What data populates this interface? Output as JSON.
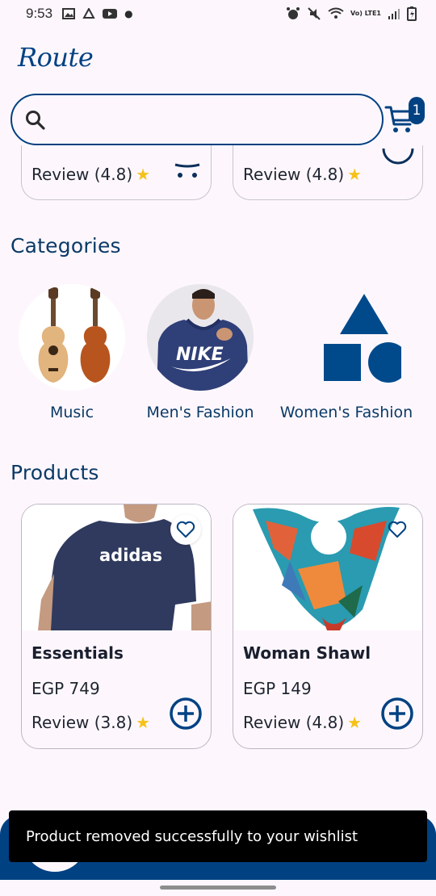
{
  "status_bar": {
    "time": "9:53",
    "network": "Vo) LTE1"
  },
  "header": {
    "logo": "Route",
    "cart_count": "1"
  },
  "search": {
    "placeholder": ""
  },
  "top_cards": [
    {
      "review": "Review (4.8)"
    },
    {
      "review": "Review (4.8)"
    }
  ],
  "categories": {
    "title": "Categories",
    "items": [
      {
        "label": "Music"
      },
      {
        "label": "Men's Fashion"
      },
      {
        "label": "Women's Fashion"
      }
    ]
  },
  "products": {
    "title": "Products",
    "items": [
      {
        "name": "Essentials",
        "price": "EGP 749",
        "review": "Review (3.8)",
        "shirt_text": "adidas"
      },
      {
        "name": "Woman Shawl",
        "price": "EGP 149",
        "review": "Review (4.8)"
      }
    ]
  },
  "snackbar": {
    "message": "Product removed successfully to your wishlist"
  },
  "colors": {
    "primary": "#004182",
    "background": "#fdf7fd",
    "star": "#f6c21a"
  },
  "icons": [
    "search-icon",
    "cart-icon",
    "heart-icon",
    "add-circle-icon",
    "star-icon"
  ]
}
